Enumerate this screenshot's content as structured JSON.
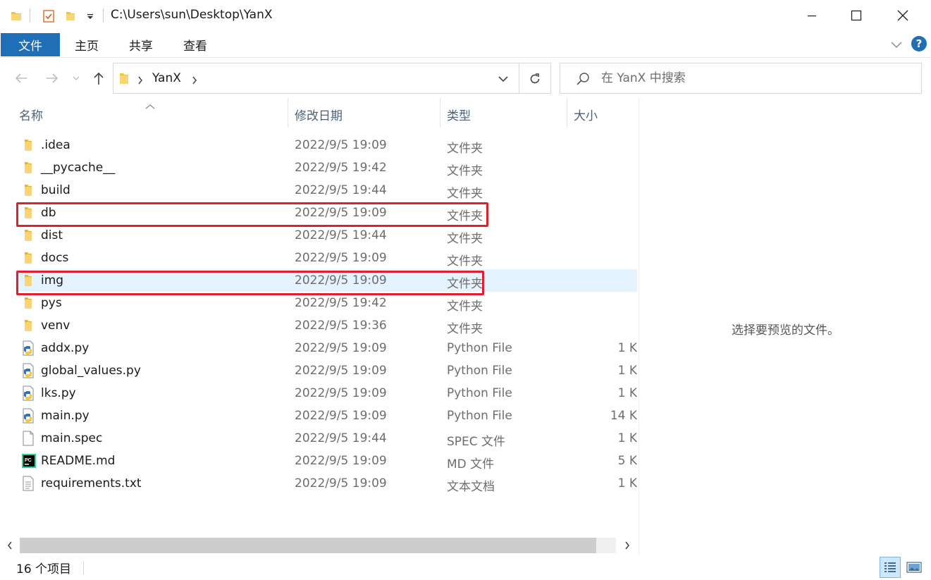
{
  "window": {
    "title_path": "C:\\Users\\sun\\Desktop\\YanX"
  },
  "ribbon": {
    "tabs": [
      "文件",
      "主页",
      "共享",
      "查看"
    ],
    "help_glyph": "?"
  },
  "nav": {
    "breadcrumb_folder": "YanX",
    "search_placeholder": "在 YanX 中搜索"
  },
  "columns": {
    "name": "名称",
    "date": "修改日期",
    "type": "类型",
    "size": "大小"
  },
  "files": [
    {
      "name": ".idea",
      "date": "2022/9/5 19:09",
      "type": "文件夹",
      "size": "",
      "icon": "folder-icon"
    },
    {
      "name": "__pycache__",
      "date": "2022/9/5 19:42",
      "type": "文件夹",
      "size": "",
      "icon": "folder-icon"
    },
    {
      "name": "build",
      "date": "2022/9/5 19:44",
      "type": "文件夹",
      "size": "",
      "icon": "folder-icon"
    },
    {
      "name": "db",
      "date": "2022/9/5 19:09",
      "type": "文件夹",
      "size": "",
      "icon": "folder-icon"
    },
    {
      "name": "dist",
      "date": "2022/9/5 19:44",
      "type": "文件夹",
      "size": "",
      "icon": "folder-icon"
    },
    {
      "name": "docs",
      "date": "2022/9/5 19:09",
      "type": "文件夹",
      "size": "",
      "icon": "folder-icon"
    },
    {
      "name": "img",
      "date": "2022/9/5 19:09",
      "type": "文件夹",
      "size": "",
      "icon": "folder-icon"
    },
    {
      "name": "pys",
      "date": "2022/9/5 19:42",
      "type": "文件夹",
      "size": "",
      "icon": "folder-icon"
    },
    {
      "name": "venv",
      "date": "2022/9/5 19:36",
      "type": "文件夹",
      "size": "",
      "icon": "folder-icon"
    },
    {
      "name": "addx.py",
      "date": "2022/9/5 19:09",
      "type": "Python File",
      "size": "1 K",
      "icon": "python-file-icon"
    },
    {
      "name": "global_values.py",
      "date": "2022/9/5 19:09",
      "type": "Python File",
      "size": "1 K",
      "icon": "python-file-icon"
    },
    {
      "name": "lks.py",
      "date": "2022/9/5 19:09",
      "type": "Python File",
      "size": "1 K",
      "icon": "python-file-icon"
    },
    {
      "name": "main.py",
      "date": "2022/9/5 19:09",
      "type": "Python File",
      "size": "14 K",
      "icon": "python-file-icon"
    },
    {
      "name": "main.spec",
      "date": "2022/9/5 19:44",
      "type": "SPEC 文件",
      "size": "1 K",
      "icon": "blank-file-icon"
    },
    {
      "name": "README.md",
      "date": "2022/9/5 19:09",
      "type": "MD 文件",
      "size": "5 K",
      "icon": "pycharm-file-icon"
    },
    {
      "name": "requirements.txt",
      "date": "2022/9/5 19:09",
      "type": "文本文档",
      "size": "1 K",
      "icon": "text-file-icon"
    }
  ],
  "preview": {
    "message": "选择要预览的文件。"
  },
  "status": {
    "item_count": "16 个项目"
  },
  "colors": {
    "accent": "#1e6fb5",
    "selection": "#e5f3ff",
    "highlight_box": "#e0202e",
    "folder": "#f2c34b"
  }
}
